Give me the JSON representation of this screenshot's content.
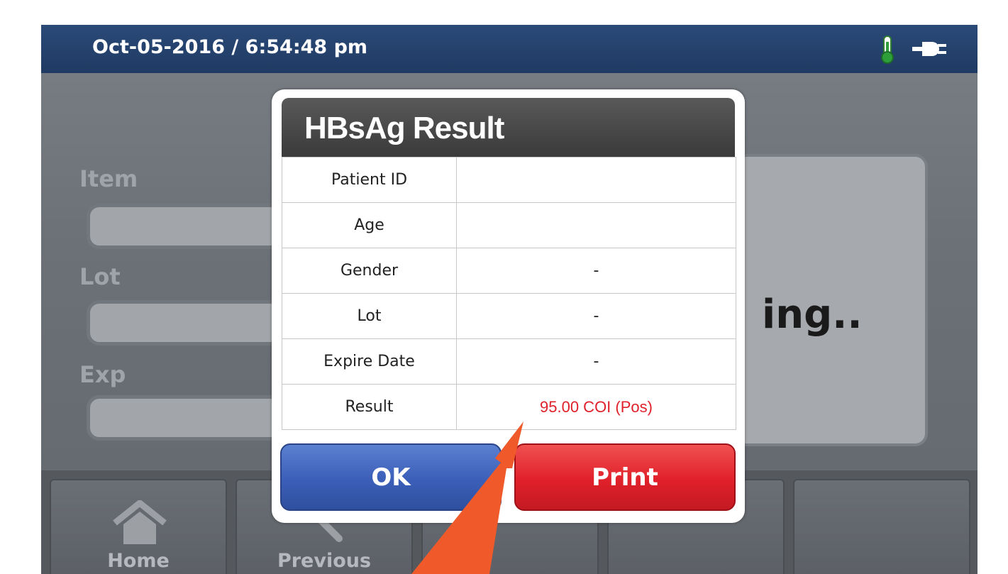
{
  "status_bar": {
    "datetime": "Oct-05-2016 / 6:54:48 pm",
    "icons": [
      "thermometer-icon",
      "power-plug-icon"
    ]
  },
  "form": {
    "item_label": "Item",
    "lot_label": "Lot",
    "exp_label": "Exp"
  },
  "panel": {
    "text": "ing.."
  },
  "nav": {
    "home_label": "Home",
    "previous_label": "Previous"
  },
  "dialog": {
    "title": "HBsAg Result",
    "rows": [
      {
        "label": "Patient ID",
        "value": ""
      },
      {
        "label": "Age",
        "value": ""
      },
      {
        "label": "Gender",
        "value": "-"
      },
      {
        "label": "Lot",
        "value": "-"
      },
      {
        "label": "Expire Date",
        "value": "-"
      },
      {
        "label": "Result",
        "value": "95.00 COI (Pos)"
      }
    ],
    "ok_label": "OK",
    "print_label": "Print"
  },
  "colors": {
    "status_bar": "#1f3a63",
    "ok_button": "#3b5fb8",
    "print_button": "#e0202a",
    "result_text": "#e0202a",
    "annotation_arrow": "#f05a2a"
  }
}
